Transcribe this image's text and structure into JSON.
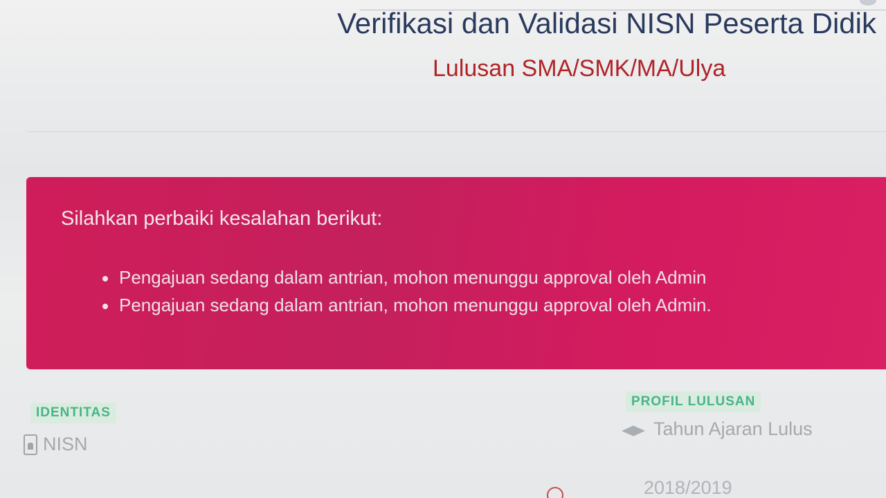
{
  "header": {
    "title": "Verifikasi dan Validasi NISN Peserta Didik",
    "subtitle": "Lulusan SMA/SMK/MA/Ulya"
  },
  "alert": {
    "heading": "Silahkan perbaiki kesalahan berikut:",
    "items": [
      "Pengajuan sedang dalam antrian, mohon menunggu approval oleh Admin",
      "Pengajuan sedang dalam antrian, mohon menunggu approval oleh Admin."
    ]
  },
  "identitas": {
    "section_label": "IDENTITAS",
    "nisn_label": "NISN"
  },
  "profil": {
    "section_label": "PROFIL LULUSAN",
    "tahun_label": "Tahun Ajaran Lulus",
    "tahun_value": "2018/2019"
  },
  "icons": {
    "nisn": "id-card-icon",
    "tahun": "graduation-cap-icon",
    "clock": "clock-icon"
  },
  "colors": {
    "title": "#2a3a5e",
    "subtitle": "#b02327",
    "alert_background": "#cf1d5a",
    "section_label": "#49b487"
  }
}
